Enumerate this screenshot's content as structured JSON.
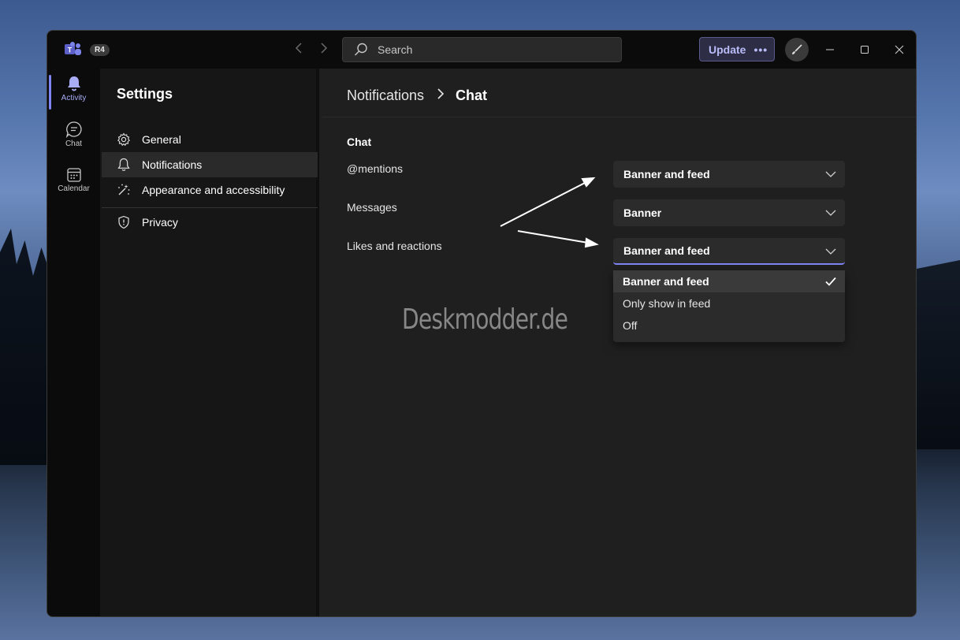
{
  "titlebar": {
    "badge": "R4",
    "search_placeholder": "Search",
    "update_label": "Update",
    "update_more": "•••"
  },
  "rail": {
    "items": [
      {
        "label": "Activity",
        "icon": "bell-icon"
      },
      {
        "label": "Chat",
        "icon": "chat-icon"
      },
      {
        "label": "Calendar",
        "icon": "calendar-icon"
      }
    ]
  },
  "settings": {
    "title": "Settings",
    "items": [
      {
        "label": "General",
        "icon": "gear-icon"
      },
      {
        "label": "Notifications",
        "icon": "bell-icon"
      },
      {
        "label": "Appearance and accessibility",
        "icon": "magic-wand-icon"
      },
      {
        "label": "Privacy",
        "icon": "shield-icon"
      }
    ]
  },
  "main": {
    "breadcrumb": {
      "parent": "Notifications",
      "separator": ">",
      "current": "Chat"
    },
    "section_title": "Chat",
    "rows": [
      {
        "label": "@mentions",
        "value": "Banner and feed"
      },
      {
        "label": "Messages",
        "value": "Banner"
      },
      {
        "label": "Likes and reactions",
        "value": "Banner and feed"
      }
    ],
    "menu_options": [
      "Banner and feed",
      "Only show in feed",
      "Off"
    ],
    "watermark": "Deskmodder.de"
  },
  "colors": {
    "accent": "#7f85f5",
    "window_bg": "#1f1f1f",
    "titlebar_bg": "#0b0b0b"
  }
}
